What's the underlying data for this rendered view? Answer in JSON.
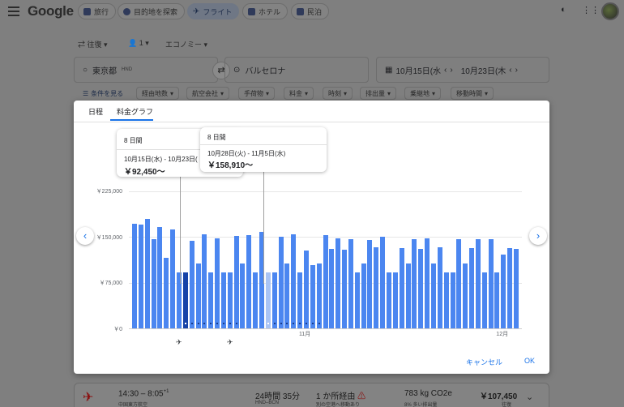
{
  "app": {
    "logo": "Google",
    "nav_chips": [
      {
        "label": "旅行",
        "active": false
      },
      {
        "label": "目的地を探索",
        "active": false
      },
      {
        "label": "フライト",
        "active": true
      },
      {
        "label": "ホテル",
        "active": false
      },
      {
        "label": "民泊",
        "active": false
      }
    ]
  },
  "search": {
    "trip_type": "往復",
    "passengers": "1",
    "cabin": "エコノミー",
    "origin": "東京都",
    "origin_code": "HND",
    "destination": "バルセロナ",
    "depart_date": "10月15日(水",
    "return_date": "10月23日(木",
    "filters": [
      "条件を見る",
      "経由地数",
      "航空会社",
      "手荷物",
      "料金",
      "時刻",
      "排出量",
      "乗継地",
      "移動時間"
    ]
  },
  "result": {
    "times": "14:30 – 8:05",
    "times_sup": "+1",
    "airline": "中国東方航空",
    "duration": "24時間 35分",
    "route": "HND–BCN",
    "stops": "1 か所経由",
    "stops_note": "別の空港へ移動あり",
    "emissions": "783 kg CO2e",
    "emissions_note": "8% 多い排出量",
    "price": "￥107,450",
    "price_note": "往復"
  },
  "modal": {
    "tabs": [
      "日程",
      "料金グラフ"
    ],
    "active_tab": 1,
    "tooltip_selected": {
      "header": "8 日間",
      "dates": "10月15日(水) - 10月23日(",
      "price": "￥92,450〜"
    },
    "tooltip_hover": {
      "header": "8 日間",
      "dates": "10月28日(火) - 11月5日(水)",
      "price": "￥158,910〜"
    },
    "cancel_label": "キャンセル",
    "ok_label": "OK"
  },
  "chart_data": {
    "type": "bar",
    "y_tick_labels": [
      "￥225,000",
      "￥150,000",
      "￥75,000",
      "￥0"
    ],
    "y_ticks": [
      225000,
      150000,
      75000,
      0
    ],
    "ylim": [
      0,
      225000
    ],
    "x_tick_labels": [
      "11月",
      "12月"
    ],
    "x_tick_index": [
      27,
      58
    ],
    "selected_index": 8,
    "hovered_index": 21,
    "values": [
      172000,
      170000,
      180000,
      146000,
      167000,
      116000,
      162000,
      92450,
      92450,
      144000,
      107000,
      155000,
      92450,
      148000,
      92450,
      92450,
      152000,
      107000,
      153000,
      92450,
      158910,
      92450,
      92450,
      150000,
      107000,
      154000,
      92450,
      128000,
      104000,
      107000,
      153000,
      131000,
      148000,
      129000,
      146000,
      92450,
      107000,
      145000,
      133000,
      150000,
      92450,
      92450,
      132000,
      107000,
      147000,
      131000,
      148000,
      107000,
      133000,
      92450,
      92450,
      146000,
      107000,
      132000,
      146000,
      92450,
      146000,
      92450,
      121000,
      132000,
      131000
    ]
  }
}
